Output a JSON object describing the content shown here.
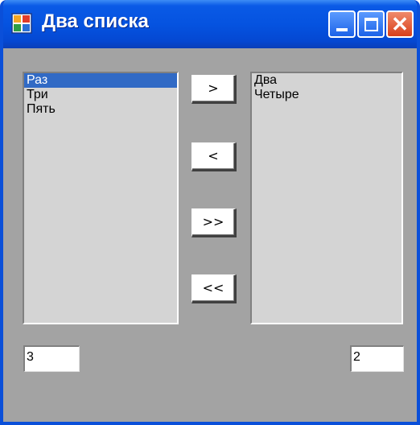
{
  "window": {
    "title": "Два списка",
    "icon": "app-window-icon"
  },
  "titlebar_buttons": {
    "minimize": "minimize-icon",
    "maximize": "maximize-icon",
    "close": "close-icon",
    "close_glyph": "✕"
  },
  "left_list": {
    "items": [
      {
        "label": "Раз",
        "selected": true
      },
      {
        "label": "Три",
        "selected": false
      },
      {
        "label": "Пять",
        "selected": false
      }
    ]
  },
  "right_list": {
    "items": [
      {
        "label": "Два",
        "selected": false
      },
      {
        "label": "Четыре",
        "selected": false
      }
    ]
  },
  "buttons": {
    "move_right": ">",
    "move_left": "<",
    "move_all_right": ">>",
    "move_all_left": "<<"
  },
  "counters": {
    "left": "3",
    "right": "2"
  },
  "colors": {
    "titlebar": "#0553e0",
    "client_bg": "#a3a3a3",
    "list_bg": "#d4d4d4",
    "selection": "#316ac5"
  }
}
